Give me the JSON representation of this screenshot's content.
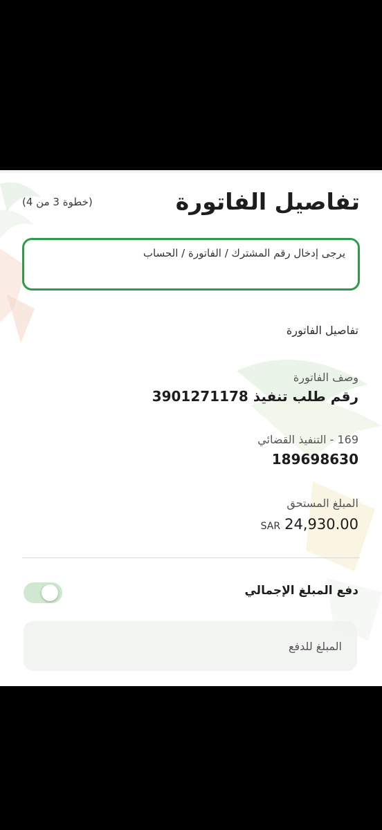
{
  "header": {
    "title": "تفاصيل الفاتورة",
    "step": "(خطوة 3 من 4)"
  },
  "notice": {
    "text": "يرجى إدخال رقم المشترك / الفاتورة / الحساب"
  },
  "details": {
    "section_title": "تفاصيل الفاتورة",
    "description_label": "وصف الفاتورة",
    "description_value": "رقم طلب تنفيذ 3901271178",
    "service_label": "169 - التنفيذ القضائي",
    "service_value": "189698630",
    "amount_label": "المبلغ المستحق",
    "amount_value": "24,930.00",
    "amount_currency": "SAR"
  },
  "payment": {
    "toggle_label": "دفع المبلغ الإجمالي",
    "toggle_on": false,
    "amount_placeholder": "المبلغ للدفع"
  },
  "colors": {
    "accent": "#2f9a4a",
    "toggle_track": "#cfe8cf"
  }
}
